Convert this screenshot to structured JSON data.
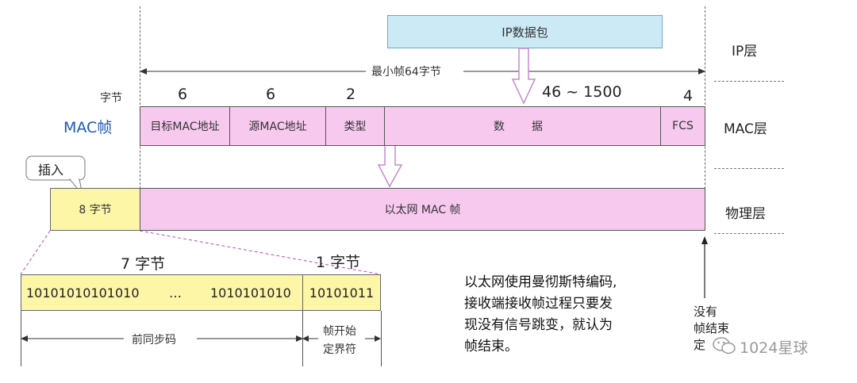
{
  "ip_packet": "IP数据包",
  "min_frame": "最小帧64字节",
  "layers": {
    "ip": "IP层",
    "mac": "MAC层",
    "phy": "物理层"
  },
  "mac_frame_title": "MAC帧",
  "bytes_label": "字节",
  "field_sizes": {
    "dst": "6",
    "src": "6",
    "type": "2",
    "data": "46 ~ 1500",
    "fcs": "4"
  },
  "fields": {
    "dst": "目标MAC地址",
    "src": "源MAC地址",
    "type": "类型",
    "data_1": "数",
    "data_2": "据",
    "fcs": "FCS"
  },
  "insert_label": "插入",
  "preamble_bytes": "8 字节",
  "ethernet_frame": "以太网 MAC 帧",
  "seven_bytes": "7 字节",
  "one_byte": "1 字节",
  "bits_left": "10101010101010",
  "bits_dots": "…",
  "bits_mid": "1010101010",
  "bits_right": "10101011",
  "preamble_code": "前同步码",
  "sfd_line1": "帧开始",
  "sfd_line2": "定界符",
  "note_lines": [
    "以太网使用曼彻斯特编码,",
    "接收端接收帧过程只要发",
    "现没有信号跳变，就认为",
    "帧结束。"
  ],
  "no_end_lines": [
    "没有",
    "帧结束",
    "定"
  ],
  "watermark": "1024星球"
}
